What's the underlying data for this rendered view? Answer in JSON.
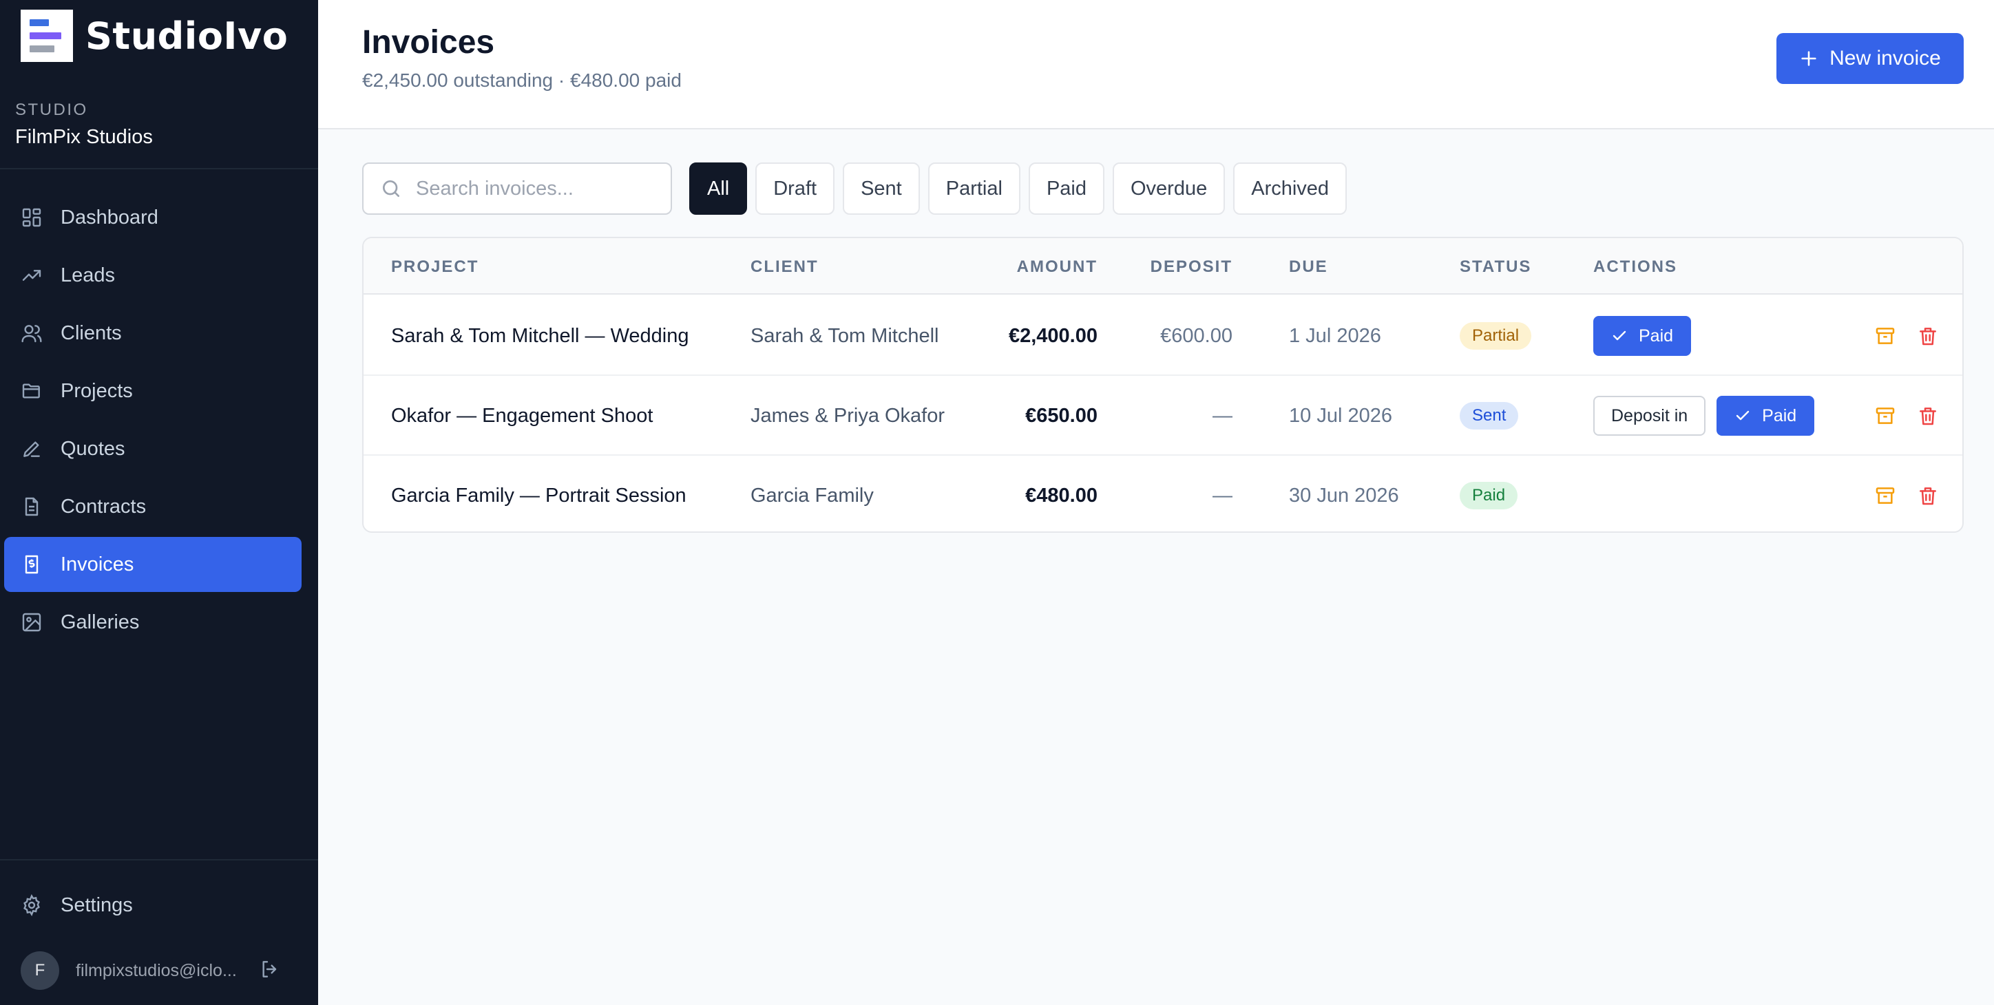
{
  "brand": {
    "name": "StudioIvo"
  },
  "studio": {
    "label": "STUDIO",
    "name": "FilmPix Studios"
  },
  "nav": [
    {
      "label": "Dashboard",
      "icon": "dashboard-icon"
    },
    {
      "label": "Leads",
      "icon": "trending-up-icon"
    },
    {
      "label": "Clients",
      "icon": "users-icon"
    },
    {
      "label": "Projects",
      "icon": "folder-icon"
    },
    {
      "label": "Quotes",
      "icon": "pen-icon"
    },
    {
      "label": "Contracts",
      "icon": "document-icon"
    },
    {
      "label": "Invoices",
      "icon": "invoice-icon",
      "active": true
    },
    {
      "label": "Galleries",
      "icon": "image-icon"
    }
  ],
  "footer": {
    "settings_label": "Settings",
    "avatar_initial": "F",
    "email": "filmpixstudios@iclo..."
  },
  "header": {
    "title": "Invoices",
    "subtitle": "€2,450.00 outstanding · €480.00 paid",
    "new_button": "New invoice"
  },
  "search": {
    "placeholder": "Search invoices..."
  },
  "filters": [
    "All",
    "Draft",
    "Sent",
    "Partial",
    "Paid",
    "Overdue",
    "Archived"
  ],
  "active_filter": "All",
  "table": {
    "columns": {
      "project": "PROJECT",
      "client": "CLIENT",
      "amount": "AMOUNT",
      "deposit": "DEPOSIT",
      "due": "DUE",
      "status": "STATUS",
      "actions": "ACTIONS"
    },
    "rows": [
      {
        "project": "Sarah & Tom Mitchell — Wedding",
        "client": "Sarah & Tom Mitchell",
        "amount": "€2,400.00",
        "deposit": "€600.00",
        "due": "1 Jul 2026",
        "status": "Partial",
        "deposit_button": "",
        "paid_button": "Paid"
      },
      {
        "project": "Okafor — Engagement Shoot",
        "client": "James & Priya Okafor",
        "amount": "€650.00",
        "deposit": "—",
        "due": "10 Jul 2026",
        "status": "Sent",
        "deposit_button": "Deposit in",
        "paid_button": "Paid"
      },
      {
        "project": "Garcia Family — Portrait Session",
        "client": "Garcia Family",
        "amount": "€480.00",
        "deposit": "—",
        "due": "30 Jun 2026",
        "status": "Paid",
        "deposit_button": "",
        "paid_button": ""
      }
    ]
  },
  "colors": {
    "accent": "#3563e9",
    "sidebar": "#111827",
    "archive": "#f59e0b",
    "delete": "#ef4444"
  }
}
